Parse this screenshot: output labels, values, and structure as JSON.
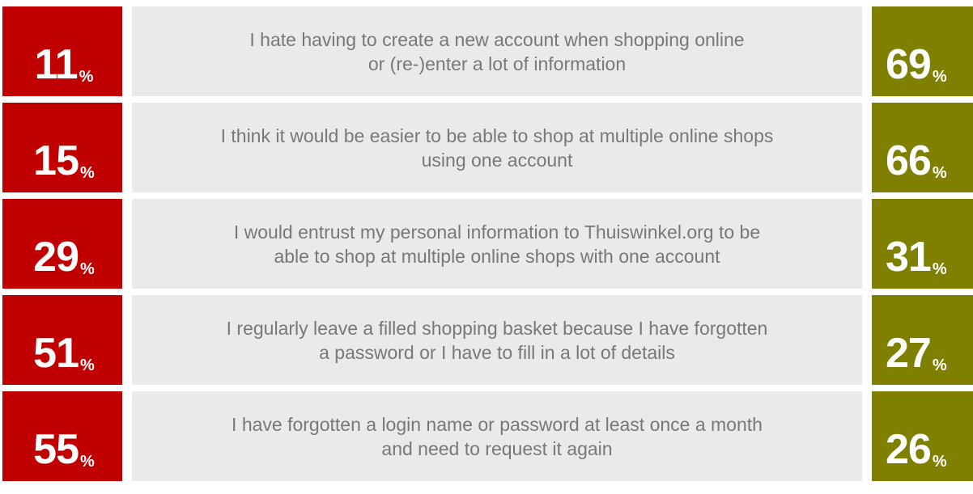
{
  "colors": {
    "left_box": "#c00000",
    "right_box": "#7f7f00",
    "statement_bg": "#eaeaea",
    "statement_text": "#787878"
  },
  "chart_data": {
    "type": "table",
    "unit": "%",
    "rows": [
      {
        "left_value": "11",
        "statement": [
          "I hate having to create a new account when shopping online",
          "or (re-)enter a lot of information"
        ],
        "right_value": "69"
      },
      {
        "left_value": "15",
        "statement": [
          "I think it would be easier to be able to shop at multiple online shops",
          "using one account"
        ],
        "right_value": "66"
      },
      {
        "left_value": "29",
        "statement": [
          "I would entrust my personal information to Thuiswinkel.org to be",
          "able to shop at multiple online shops with one account"
        ],
        "right_value": "31"
      },
      {
        "left_value": "51",
        "statement": [
          "I regularly leave a filled shopping basket because I have forgotten",
          "a password or I have to fill in a lot of details"
        ],
        "right_value": "27"
      },
      {
        "left_value": "55",
        "statement": [
          "I have forgotten a login name or password at least once a month",
          "and need to request it again"
        ],
        "right_value": "26"
      }
    ]
  }
}
